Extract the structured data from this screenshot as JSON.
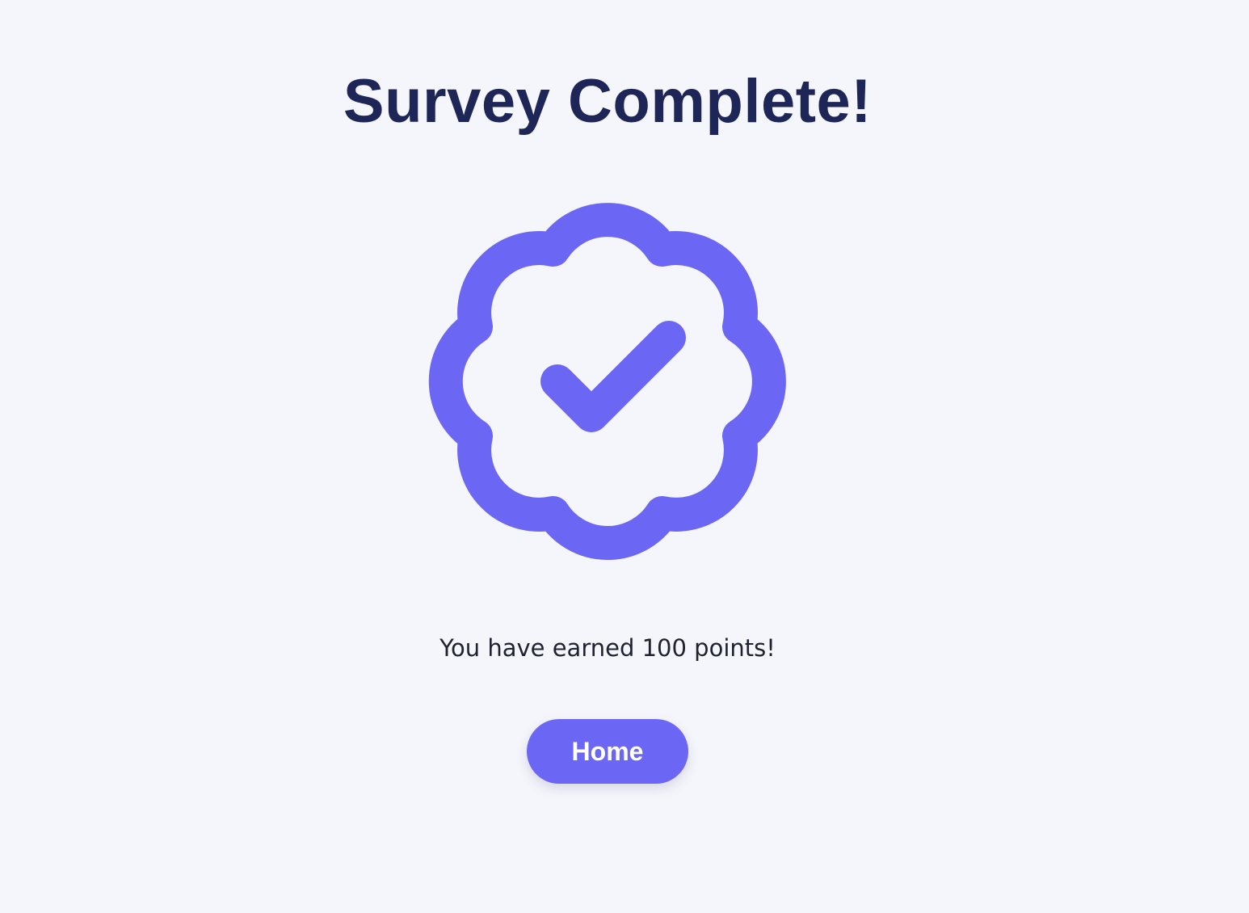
{
  "page": {
    "title": "Survey Complete!",
    "badge_icon": "verified-badge-check-icon",
    "message": "You have earned 100 points!",
    "home_button_label": "Home"
  },
  "colors": {
    "background": "#f5f6fb",
    "title": "#1e2557",
    "accent": "#6c66f5",
    "text": "#1f2230",
    "button_text": "#ffffff"
  }
}
